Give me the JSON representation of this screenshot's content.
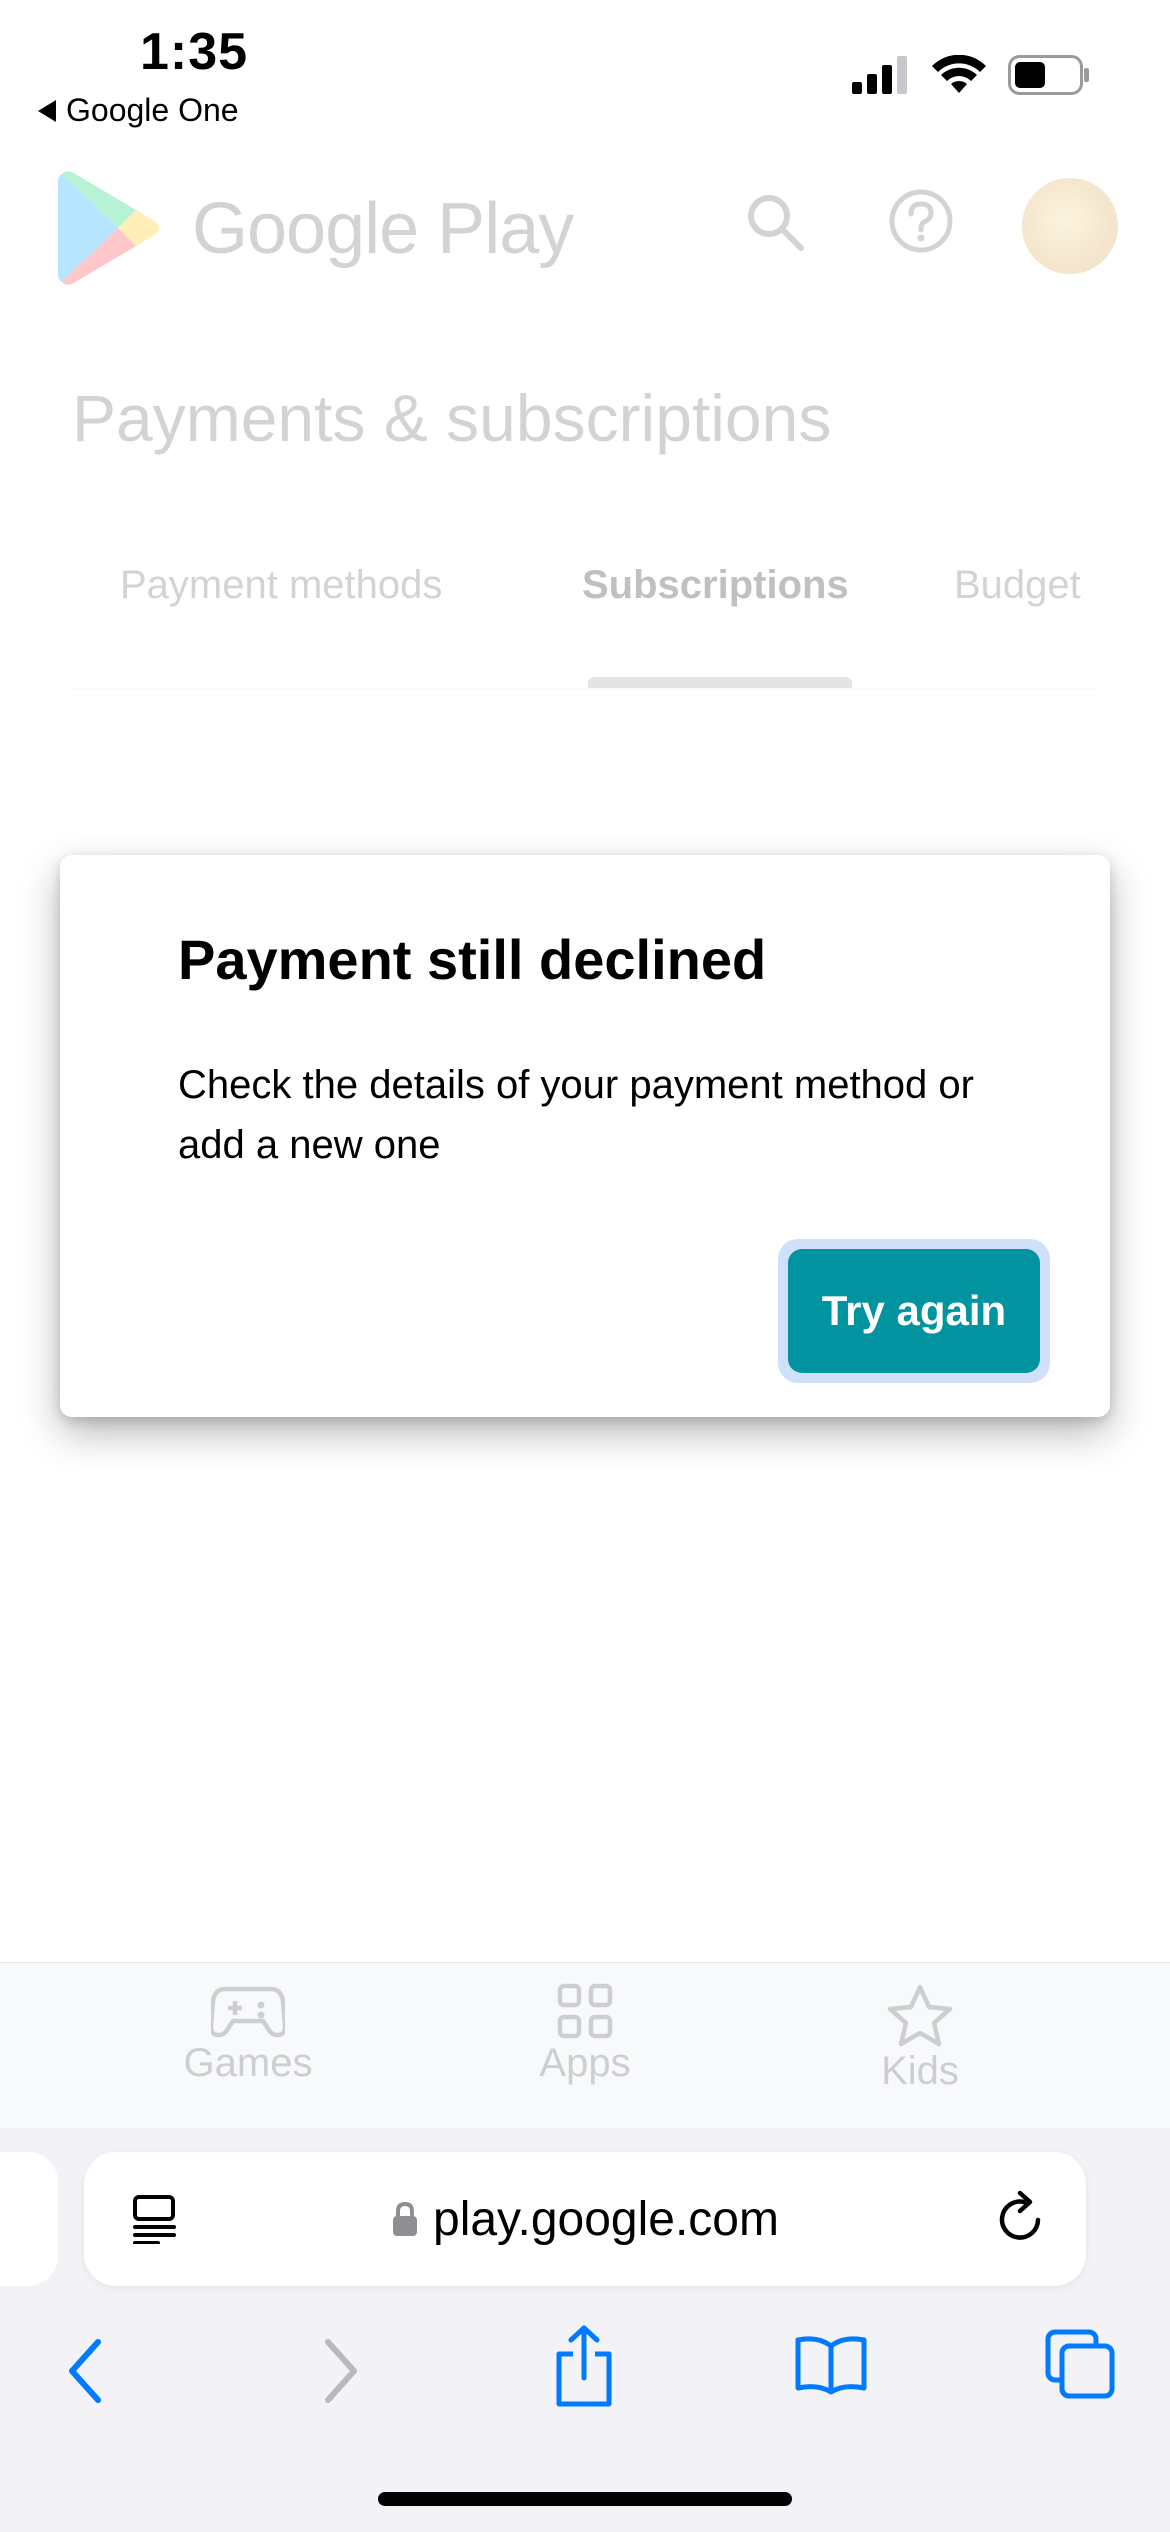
{
  "status_bar": {
    "time": "1:35",
    "back_app": "Google One"
  },
  "header": {
    "brand": "Google Play",
    "icons": [
      "search-icon",
      "help-icon",
      "avatar"
    ]
  },
  "page": {
    "title": "Payments & subscriptions",
    "tabs": [
      {
        "label": "Payment methods",
        "active": false
      },
      {
        "label": "Subscriptions",
        "active": true
      },
      {
        "label": "Budget",
        "active": false
      }
    ]
  },
  "dialog": {
    "title": "Payment still declined",
    "body": "Check the details of your payment method or add a new one",
    "button_label": "Try again",
    "button_color": "#01939f"
  },
  "bottom_nav": {
    "items": [
      {
        "label": "Games",
        "icon": "gamepad-icon"
      },
      {
        "label": "Apps",
        "icon": "apps-grid-icon"
      },
      {
        "label": "Kids",
        "icon": "star-icon"
      }
    ]
  },
  "browser": {
    "url": "play.google.com",
    "icons": [
      "reader-icon",
      "lock-icon",
      "reload-icon",
      "back-icon",
      "forward-icon",
      "share-icon",
      "bookmarks-icon",
      "tabs-icon"
    ],
    "accent": "#007aff"
  }
}
